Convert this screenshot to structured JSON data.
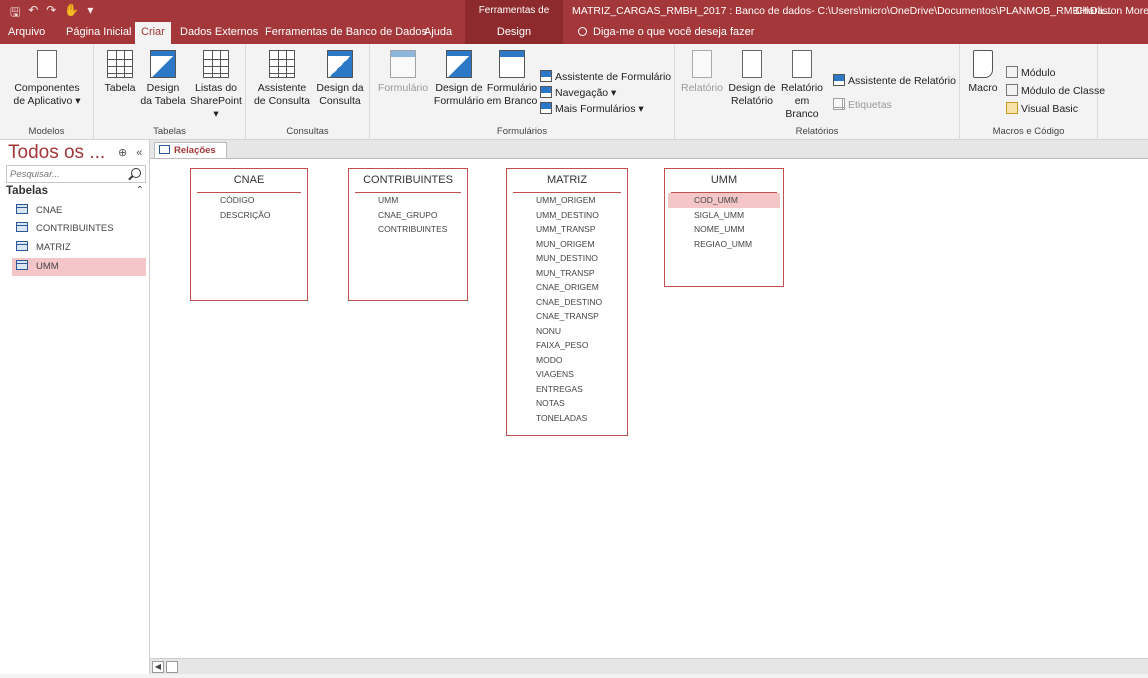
{
  "titlebar": {
    "quick_access": [
      "save-icon",
      "undo-icon",
      "redo-icon",
      "touch-icon",
      "customize-icon"
    ],
    "context_title": "Ferramentas de Relação",
    "document_title": "MATRIZ_CARGAS_RMBH_2017 : Banco de dados- C:\\Users\\micro\\OneDrive\\Documentos\\PLANMOB_RMBH\\Da...",
    "user": "Charliston Morei"
  },
  "tabs": {
    "arquivo": "Arquivo",
    "pagina_inicial": "Página Inicial",
    "criar": "Criar",
    "dados_externos": "Dados Externos",
    "ferramentas_bd": "Ferramentas de Banco de Dados",
    "ajuda": "Ajuda",
    "design": "Design",
    "tell_me": "Diga-me o que você deseja fazer"
  },
  "ribbon": {
    "modelos": {
      "label": "Modelos",
      "componentes_l1": "Componentes",
      "componentes_l2": "de Aplicativo ▾"
    },
    "tabelas": {
      "label": "Tabelas",
      "tabela": "Tabela",
      "design_l1": "Design",
      "design_l2": "da Tabela",
      "listas_l1": "Listas do",
      "listas_l2": "SharePoint ▾"
    },
    "consultas": {
      "label": "Consultas",
      "assistente_l1": "Assistente",
      "assistente_l2": "de Consulta",
      "design_l1": "Design da",
      "design_l2": "Consulta"
    },
    "formularios": {
      "label": "Formulários",
      "formulario": "Formulário",
      "design_l1": "Design de",
      "design_l2": "Formulário",
      "branco_l1": "Formulário",
      "branco_l2": "em Branco",
      "assistente": "Assistente de Formulário",
      "navegacao": "Navegação ▾",
      "mais": "Mais Formulários ▾"
    },
    "relatorios": {
      "label": "Relatórios",
      "relatorio": "Relatório",
      "design_l1": "Design de",
      "design_l2": "Relatório",
      "branco_l1": "Relatório",
      "branco_l2": "em Branco",
      "assistente": "Assistente de Relatório",
      "etiquetas": "Etiquetas"
    },
    "macros": {
      "label": "Macros e Código",
      "macro": "Macro",
      "modulo": "Módulo",
      "modulo_classe": "Módulo de Classe",
      "visual_basic": "Visual Basic"
    }
  },
  "nav": {
    "title": "Todos os ...",
    "search_placeholder": "Pesquisar...",
    "section": "Tabelas",
    "items": [
      {
        "label": "CNAE"
      },
      {
        "label": "CONTRIBUINTES"
      },
      {
        "label": "MATRIZ"
      },
      {
        "label": "UMM"
      }
    ]
  },
  "doc": {
    "tab_label": "Relações"
  },
  "tables": [
    {
      "name": "CNAE",
      "fields": [
        "CÓDIGO",
        "DESCRIÇÃO"
      ]
    },
    {
      "name": "CONTRIBUINTES",
      "fields": [
        "UMM",
        "CNAE_GRUPO",
        "CONTRIBUINTES"
      ]
    },
    {
      "name": "MATRIZ",
      "fields": [
        "UMM_ORIGEM",
        "UMM_DESTINO",
        "UMM_TRANSP",
        "MUN_ORIGEM",
        "MUN_DESTINO",
        "MUN_TRANSP",
        "CNAE_ORIGEM",
        "CNAE_DESTINO",
        "CNAE_TRANSP",
        "NONU",
        "FAIXA_PESO",
        "MODO",
        "VIAGENS",
        "ENTREGAS",
        "NOTAS",
        "TONELADAS"
      ]
    },
    {
      "name": "UMM",
      "fields": [
        "COD_UMM",
        "SIGLA_UMM",
        "NOME_UMM",
        "REGIAO_UMM"
      ]
    }
  ],
  "colors": {
    "accent": "#a4373a",
    "selection": "#f4c6c8",
    "table_border": "#c0504d"
  }
}
